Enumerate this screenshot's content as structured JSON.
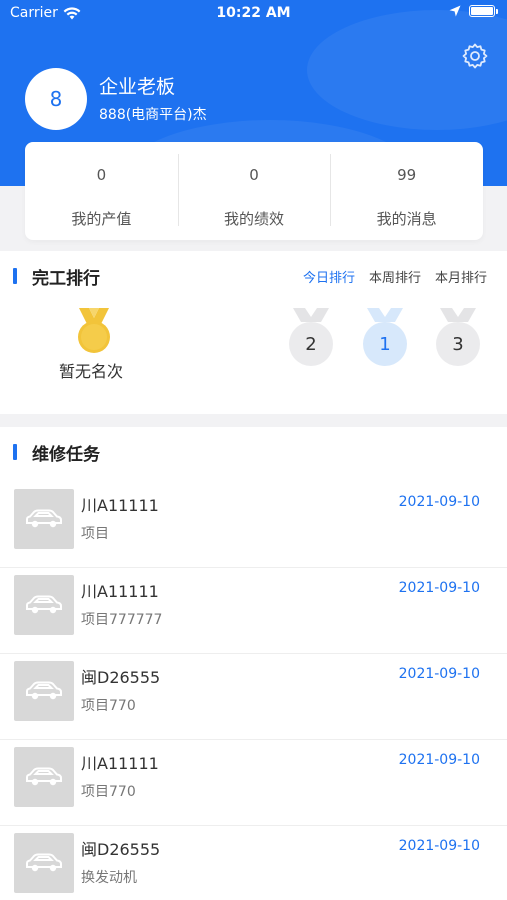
{
  "status_bar": {
    "carrier": "Carrier",
    "time": "10:22 AM"
  },
  "profile": {
    "avatar_text": "8",
    "title": "企业老板",
    "subtitle": "888(电商平台)杰"
  },
  "stats": [
    {
      "value": "0",
      "label": "我的产值"
    },
    {
      "value": "0",
      "label": "我的绩效"
    },
    {
      "value": "99",
      "label": "我的消息"
    }
  ],
  "ranking": {
    "title": "完工排行",
    "tabs": [
      "今日排行",
      "本周排行",
      "本月排行"
    ],
    "active_tab": 0,
    "no_rank_text": "暂无名次",
    "podium": [
      "2",
      "1",
      "3"
    ]
  },
  "tasks": {
    "title": "维修任务",
    "items": [
      {
        "plate": "川A11111",
        "item": "项目",
        "date": "2021-09-10"
      },
      {
        "plate": "川A11111",
        "item": "项目777777",
        "date": "2021-09-10"
      },
      {
        "plate": "闽D26555",
        "item": "项目770",
        "date": "2021-09-10"
      },
      {
        "plate": "川A11111",
        "item": "项目770",
        "date": "2021-09-10"
      },
      {
        "plate": "闽D26555",
        "item": "换发动机",
        "date": "2021-09-10"
      }
    ]
  },
  "icons": {
    "settings": "gear-icon",
    "medal": "gold-medal-icon",
    "task_thumbnail": "car-icon",
    "wifi": "wifi-icon",
    "location": "location-arrow-icon",
    "battery": "battery-icon"
  },
  "colors": {
    "primary": "#1e72f0",
    "gold": "#f2c43a",
    "silver": "#ebebed",
    "podium_first": "#d7e8fb"
  }
}
